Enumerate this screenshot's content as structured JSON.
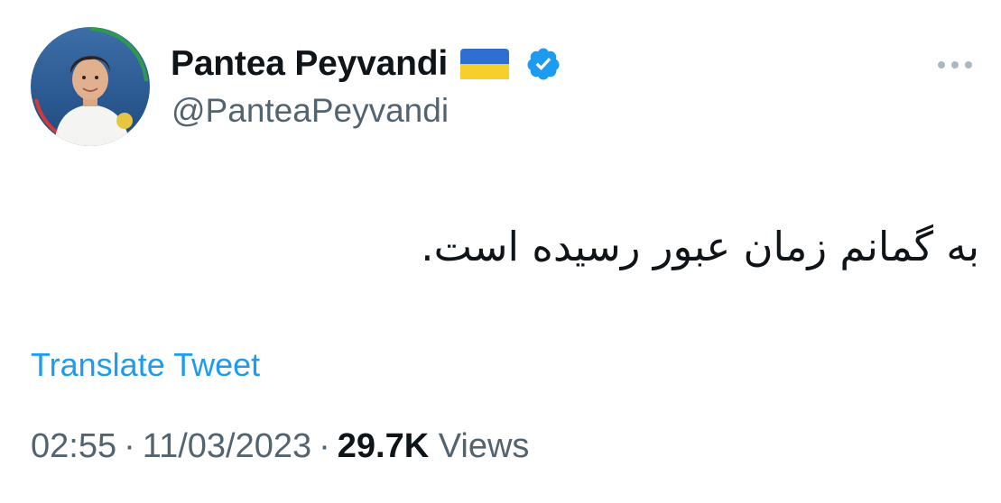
{
  "author": {
    "display_name": "Pantea Peyvandi",
    "handle": "@PanteaPeyvandi",
    "flag_emoji": "🇺🇦",
    "flag_icon": "ukraine-flag-icon",
    "verified_icon": "verified-badge-icon",
    "verified_color": "#1d9bf0"
  },
  "tweet": {
    "text": "به گمانم زمان عبور رسیده است."
  },
  "actions": {
    "translate_label": "Translate Tweet",
    "more_icon": "more-icon"
  },
  "meta": {
    "time": "02:55",
    "separator": "·",
    "date": "11/03/2023",
    "views_count": "29.7K",
    "views_label": "Views"
  },
  "colors": {
    "text_primary": "#0f1419",
    "text_secondary": "#536471",
    "link": "#1d9bf0"
  }
}
